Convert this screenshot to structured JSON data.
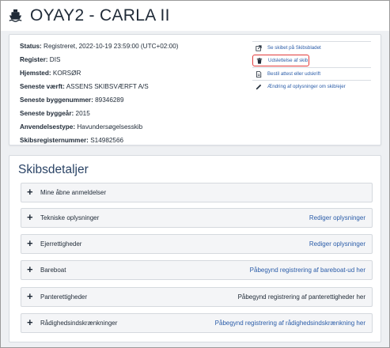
{
  "header": {
    "title": "OYAY2 - CARLA II",
    "icon": "ship-icon"
  },
  "info": {
    "status_label": "Status:",
    "status_value": "Registreret, 2022-10-19 23:59:00 (UTC+02:00)",
    "register_label": "Register:",
    "register_value": "DIS",
    "hjemsted_label": "Hjemsted:",
    "hjemsted_value": "KORSØR",
    "vaerft_label": "Seneste værft:",
    "vaerft_value": "ASSENS SKIBSVÆRFT A/S",
    "byggenummer_label": "Seneste byggenummer:",
    "byggenummer_value": "89346289",
    "byggeaar_label": "Seneste byggeår:",
    "byggeaar_value": "2015",
    "anvendelse_label": "Anvendelsestype:",
    "anvendelse_value": "Havundersøgelsesskib",
    "skibsreg_label": "Skibsregisternummer:",
    "skibsreg_value": "S14982566"
  },
  "actions": [
    {
      "label": "Se skibet på Skibsbladet",
      "icon": "external-link-icon"
    },
    {
      "label": "Udslettelse af skib",
      "icon": "trash-icon"
    },
    {
      "label": "Bestil attest eller udskrift",
      "icon": "document-icon"
    },
    {
      "label": "Ændring af oplysninger om skib/ejer",
      "icon": "pencil-icon"
    }
  ],
  "details": {
    "title": "Skibsdetaljer",
    "sections": [
      {
        "label": "Mine åbne anmeldelser",
        "link": ""
      },
      {
        "label": "Tekniske oplysninger",
        "link": "Rediger oplysninger"
      },
      {
        "label": "Ejerrettigheder",
        "link": "Rediger oplysninger"
      },
      {
        "label": "Bareboat",
        "link": "Påbegynd registrering af bareboat-ud her"
      },
      {
        "label": "Panterettigheder",
        "link": "Påbegynd registrering af panterettigheder her"
      },
      {
        "label": "Rådighedsindskrænkninger",
        "link": "Påbegynd registrering af rådighedsindskrænkning her"
      }
    ]
  },
  "colors": {
    "link": "#2a5ca8",
    "highlight": "#e23b3b",
    "heading": "#2b4466"
  }
}
